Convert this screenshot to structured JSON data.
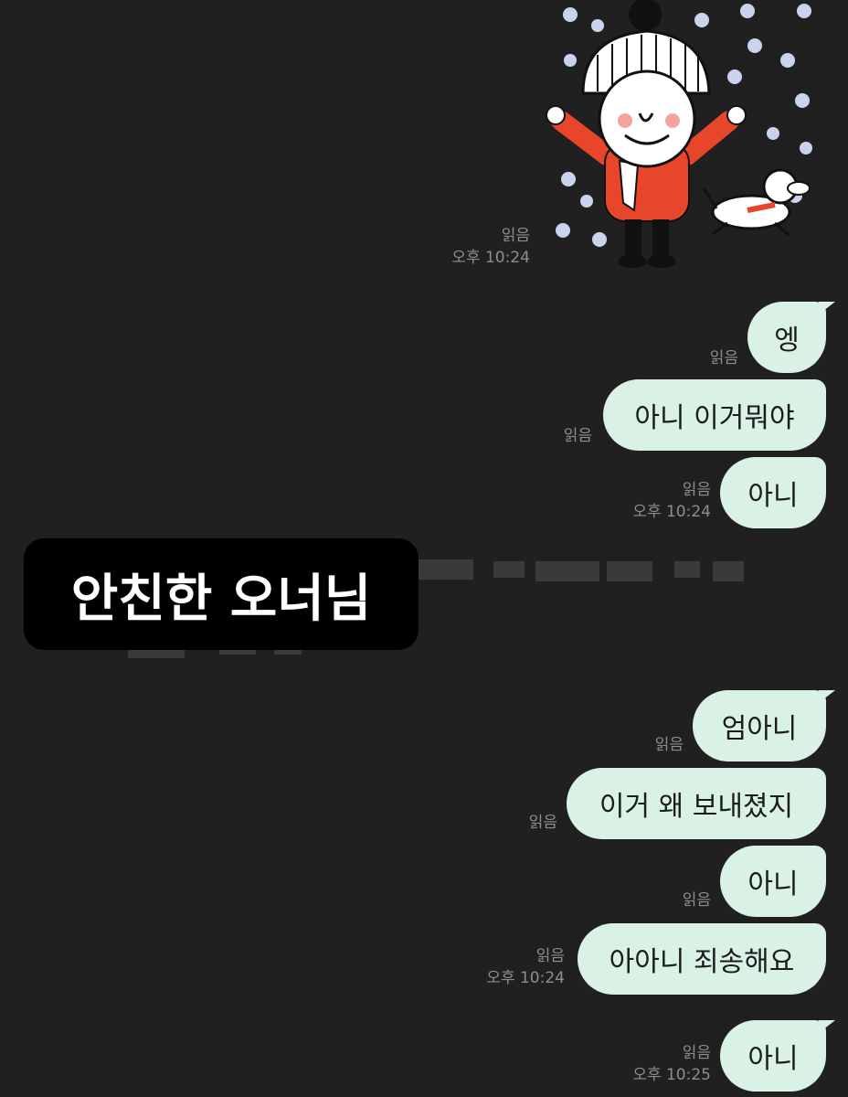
{
  "sticker": {
    "icon": "snowman-boy-and-dog-sticker"
  },
  "sticker_meta": {
    "read": "읽음",
    "time": "오후 10:24"
  },
  "messages": [
    {
      "text": "엥",
      "read": "읽음"
    },
    {
      "text": "아니 이거뭐야",
      "read": "읽음"
    },
    {
      "text": "아니",
      "read": "읽음",
      "time": "오후 10:24"
    },
    {
      "text": "엄아니",
      "read": "읽음"
    },
    {
      "text": "이거 왜 보내졌지",
      "read": "읽음"
    },
    {
      "text": "아니",
      "read": "읽음"
    },
    {
      "text": "아아니 죄송해요",
      "read": "읽음",
      "time": "오후 10:24"
    },
    {
      "text": "아니",
      "read": "읽음",
      "time": "오후 10:25"
    }
  ],
  "overlay": {
    "label": "안친한 오너님"
  },
  "colors": {
    "background": "#202020",
    "bubble": "#d9f2e5",
    "meta_text": "#8e8e8e"
  }
}
